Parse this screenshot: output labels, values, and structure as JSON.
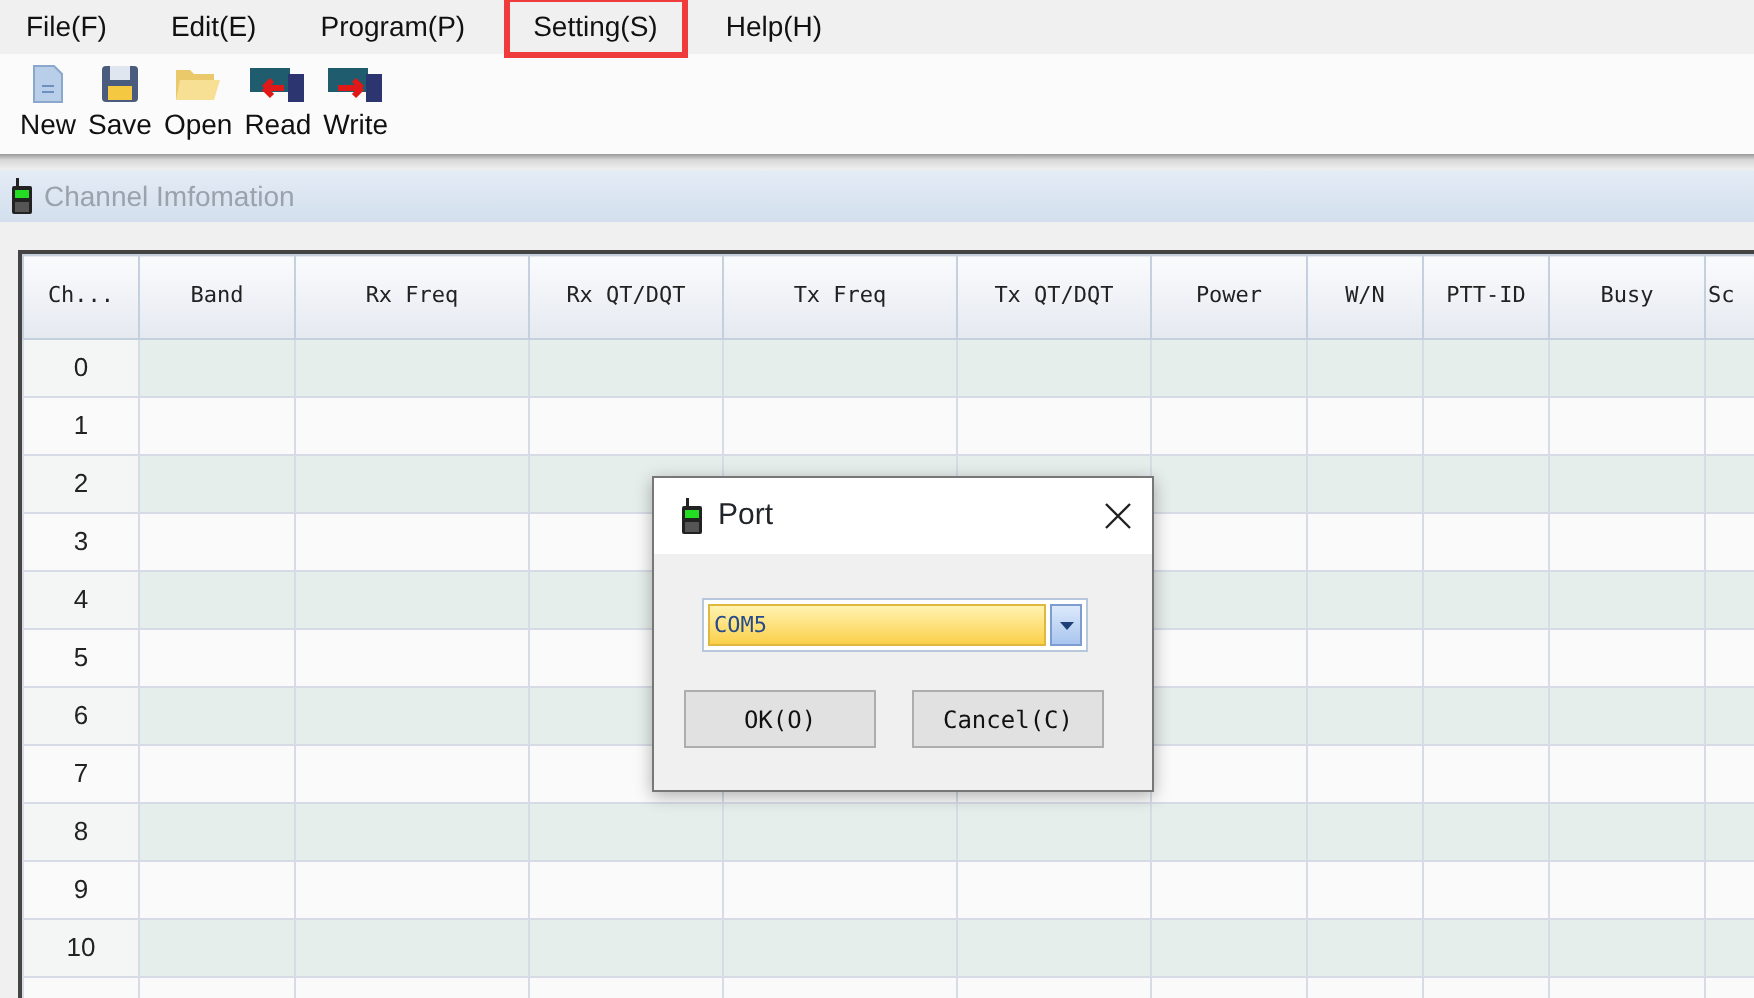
{
  "menu": [
    {
      "label": "File(F)",
      "highlighted": false
    },
    {
      "label": "Edit(E)",
      "highlighted": false
    },
    {
      "label": "Program(P)",
      "highlighted": false
    },
    {
      "label": "Setting(S)",
      "highlighted": true
    },
    {
      "label": "Help(H)",
      "highlighted": false
    }
  ],
  "toolbar": [
    {
      "label": "New",
      "kind": "new"
    },
    {
      "label": "Save",
      "kind": "save"
    },
    {
      "label": "Open",
      "kind": "open"
    },
    {
      "label": "Read",
      "kind": "read"
    },
    {
      "label": "Write",
      "kind": "write"
    }
  ],
  "panel": {
    "title": "Channel Imfomation"
  },
  "table": {
    "columns": [
      "Ch...",
      "Band",
      "Rx Freq",
      "Rx QT/DQT",
      "Tx Freq",
      "Tx QT/DQT",
      "Power",
      "W/N",
      "PTT-ID",
      "Busy",
      "Sc"
    ],
    "rows": [
      "0",
      "1",
      "2",
      "3",
      "4",
      "5",
      "6",
      "7",
      "8",
      "9",
      "10"
    ]
  },
  "dialog": {
    "title": "Port",
    "port": "COM5",
    "buttons": [
      "OK(O)",
      "Cancel(C)"
    ]
  }
}
